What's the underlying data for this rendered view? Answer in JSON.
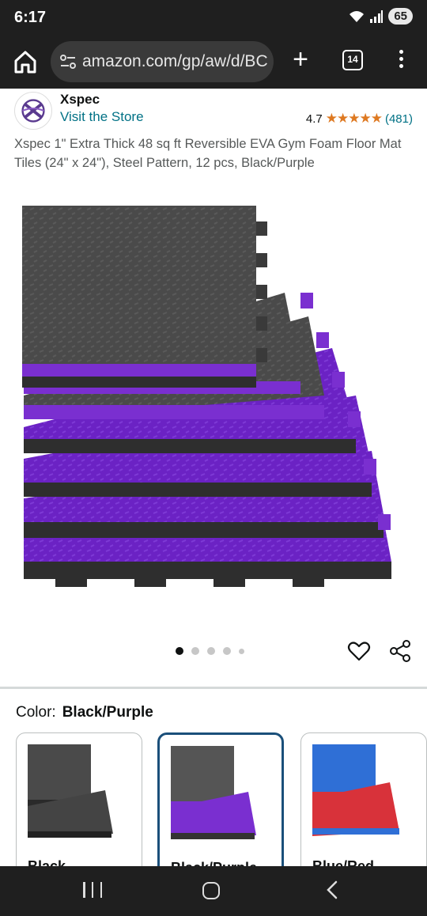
{
  "status_bar": {
    "time": "6:17",
    "battery": "65",
    "icons": [
      "wifi-icon",
      "signal-icon",
      "battery-icon"
    ]
  },
  "browser": {
    "url": "amazon.com/gp/aw/d/BC",
    "tab_count": "14",
    "icons": [
      "home-icon",
      "site-settings-icon",
      "new-tab-icon",
      "tabs-icon",
      "overflow-menu-icon"
    ]
  },
  "brand": {
    "name": "Xspec",
    "store_link": "Visit the Store",
    "logo_icon": "brand-logo-icon"
  },
  "rating": {
    "value": "4.7",
    "stars_glyph": "★★★★★",
    "review_count": "(481)"
  },
  "product": {
    "title": "Xspec 1\" Extra Thick 48 sq ft Reversible EVA Gym Foam Floor Mat Tiles (24\" x 24\"), Steel Pattern, 12 pcs, Black/Purple"
  },
  "gallery": {
    "image_count": 5,
    "active_index": 0
  },
  "colors": {
    "label": "Color:",
    "selected": "Black/Purple",
    "options": [
      {
        "label": "Black",
        "top": "#444444",
        "side": "#2b2b2b"
      },
      {
        "label": "Black/Purple",
        "top": "#555555",
        "side": "#7a2fd0"
      },
      {
        "label": "Blue/Red",
        "top": "#2f6fd6",
        "side": "#d8323a"
      }
    ],
    "accent_selected": "#1a4f7a",
    "link_color": "#007185",
    "star_color": "#de7921"
  }
}
